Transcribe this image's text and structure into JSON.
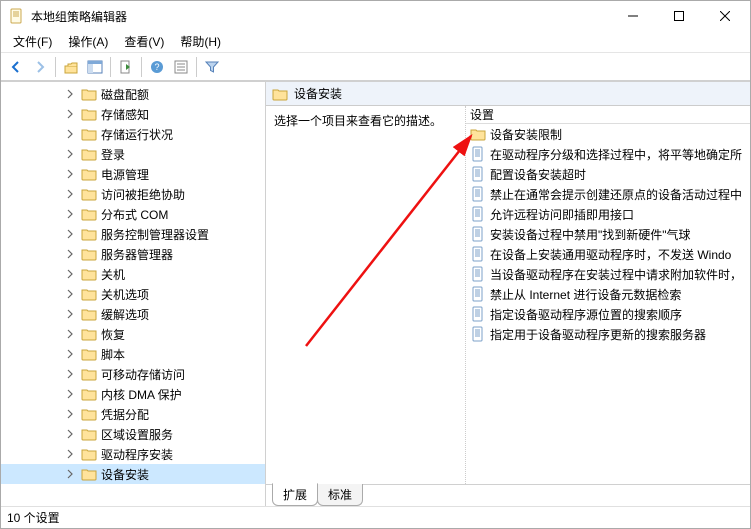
{
  "window": {
    "title": "本地组策略编辑器"
  },
  "menu": {
    "file": "文件(F)",
    "action": "操作(A)",
    "view": "查看(V)",
    "help": "帮助(H)"
  },
  "tree": {
    "items": [
      {
        "label": "磁盘配额"
      },
      {
        "label": "存储感知"
      },
      {
        "label": "存储运行状况"
      },
      {
        "label": "登录"
      },
      {
        "label": "电源管理"
      },
      {
        "label": "访问被拒绝协助"
      },
      {
        "label": "分布式 COM"
      },
      {
        "label": "服务控制管理器设置"
      },
      {
        "label": "服务器管理器"
      },
      {
        "label": "关机"
      },
      {
        "label": "关机选项"
      },
      {
        "label": "缓解选项"
      },
      {
        "label": "恢复"
      },
      {
        "label": "脚本"
      },
      {
        "label": "可移动存储访问"
      },
      {
        "label": "内核 DMA 保护"
      },
      {
        "label": "凭据分配"
      },
      {
        "label": "区域设置服务"
      },
      {
        "label": "驱动程序安装"
      },
      {
        "label": "设备安装",
        "selected": true
      }
    ]
  },
  "details": {
    "header": "设备安装",
    "desc_prompt": "选择一个项目来查看它的描述。",
    "column_header": "设置",
    "items": [
      {
        "label": "设备安装限制",
        "type": "folder"
      },
      {
        "label": "在驱动程序分级和选择过程中，将平等地确定所",
        "type": "policy"
      },
      {
        "label": "配置设备安装超时",
        "type": "policy"
      },
      {
        "label": "禁止在通常会提示创建还原点的设备活动过程中",
        "type": "policy"
      },
      {
        "label": "允许远程访问即插即用接口",
        "type": "policy"
      },
      {
        "label": "安装设备过程中禁用\"找到新硬件\"气球",
        "type": "policy"
      },
      {
        "label": "在设备上安装通用驱动程序时，不发送 Windo",
        "type": "policy"
      },
      {
        "label": "当设备驱动程序在安装过程中请求附加软件时，",
        "type": "policy"
      },
      {
        "label": "禁止从 Internet 进行设备元数据检索",
        "type": "policy"
      },
      {
        "label": "指定设备驱动程序源位置的搜索顺序",
        "type": "policy"
      },
      {
        "label": "指定用于设备驱动程序更新的搜索服务器",
        "type": "policy"
      }
    ]
  },
  "bottom_tabs": {
    "extended": "扩展",
    "standard": "标准"
  },
  "status": {
    "count_label": "10 个设置"
  }
}
